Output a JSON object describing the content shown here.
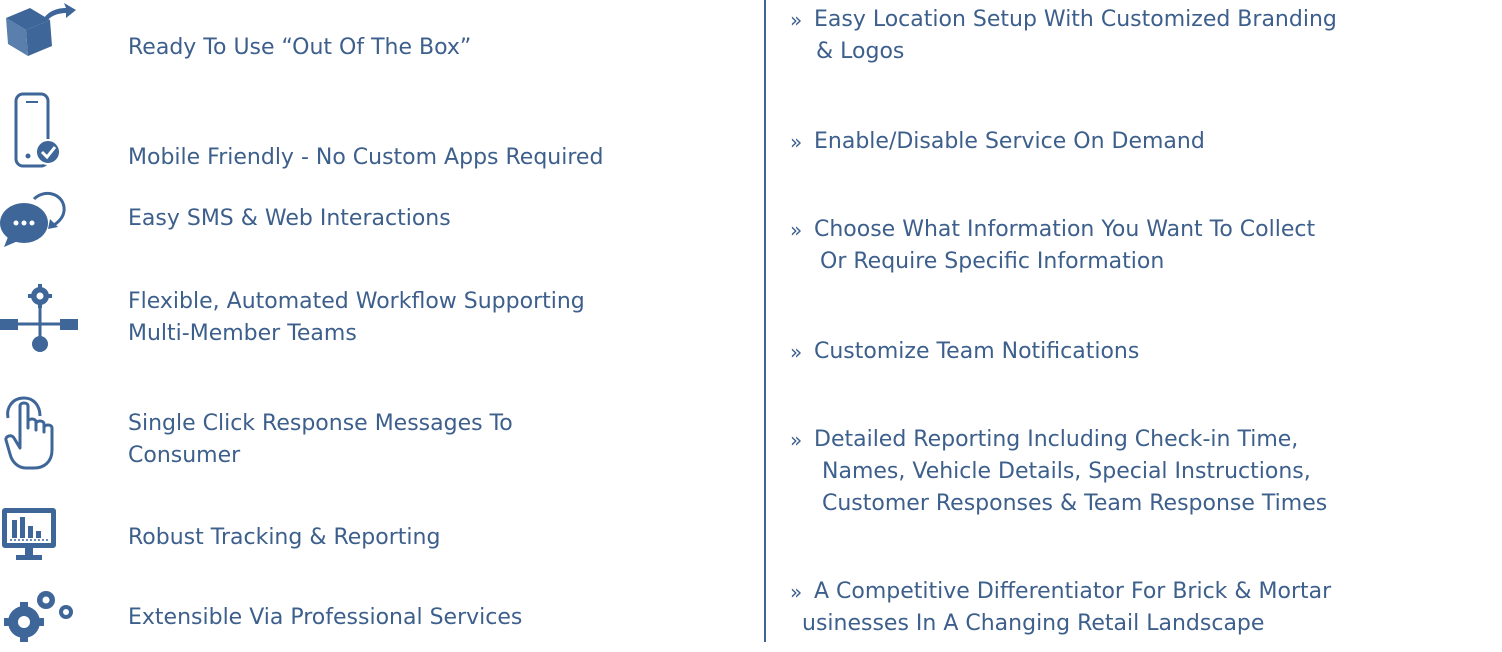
{
  "colors": {
    "text": "#3d5f8c",
    "icon": "#3e6698",
    "divider": "#3e6698"
  },
  "features": [
    {
      "icon": "open-box-arrow-icon",
      "label": "Ready To Use “Out Of The Box”"
    },
    {
      "icon": "mobile-check-icon",
      "label": "Mobile Friendly - No Custom Apps Required"
    },
    {
      "icon": "chat-refresh-icon",
      "label": "Easy SMS & Web Interactions"
    },
    {
      "icon": "workflow-gear-icon",
      "label": "Flexible, Automated Workflow Supporting\nMulti-Member Teams"
    },
    {
      "icon": "hand-tap-icon",
      "label": "Single Click Response Messages To\nConsumer"
    },
    {
      "icon": "monitor-chart-icon",
      "label": "Robust Tracking & Reporting"
    },
    {
      "icon": "gears-icon",
      "label": "Extensible Via Professional Services"
    }
  ],
  "bullets": [
    {
      "marker": "»",
      "line1": "Easy Location Setup With Customized Branding",
      "line2": "& Logos",
      "line3": ""
    },
    {
      "marker": "»",
      "line1": "Enable/Disable Service On Demand",
      "line2": "",
      "line3": ""
    },
    {
      "marker": "»",
      "line1": "Choose What Information You Want To Collect",
      "line2": "Or Require Specific Information",
      "line3": ""
    },
    {
      "marker": "»",
      "line1": "Customize Team Notifications",
      "line2": "",
      "line3": ""
    },
    {
      "marker": "»",
      "line1": "Detailed Reporting Including Check-in Time,",
      "line2": "Names, Vehicle Details, Special Instructions,",
      "line3": "Customer Responses & Team Response Times"
    },
    {
      "marker": "»",
      "line1": "A Competitive Differentiator For Brick & Mortar",
      "line2": "usinesses In A Changing Retail Landscape",
      "line3": ""
    }
  ]
}
